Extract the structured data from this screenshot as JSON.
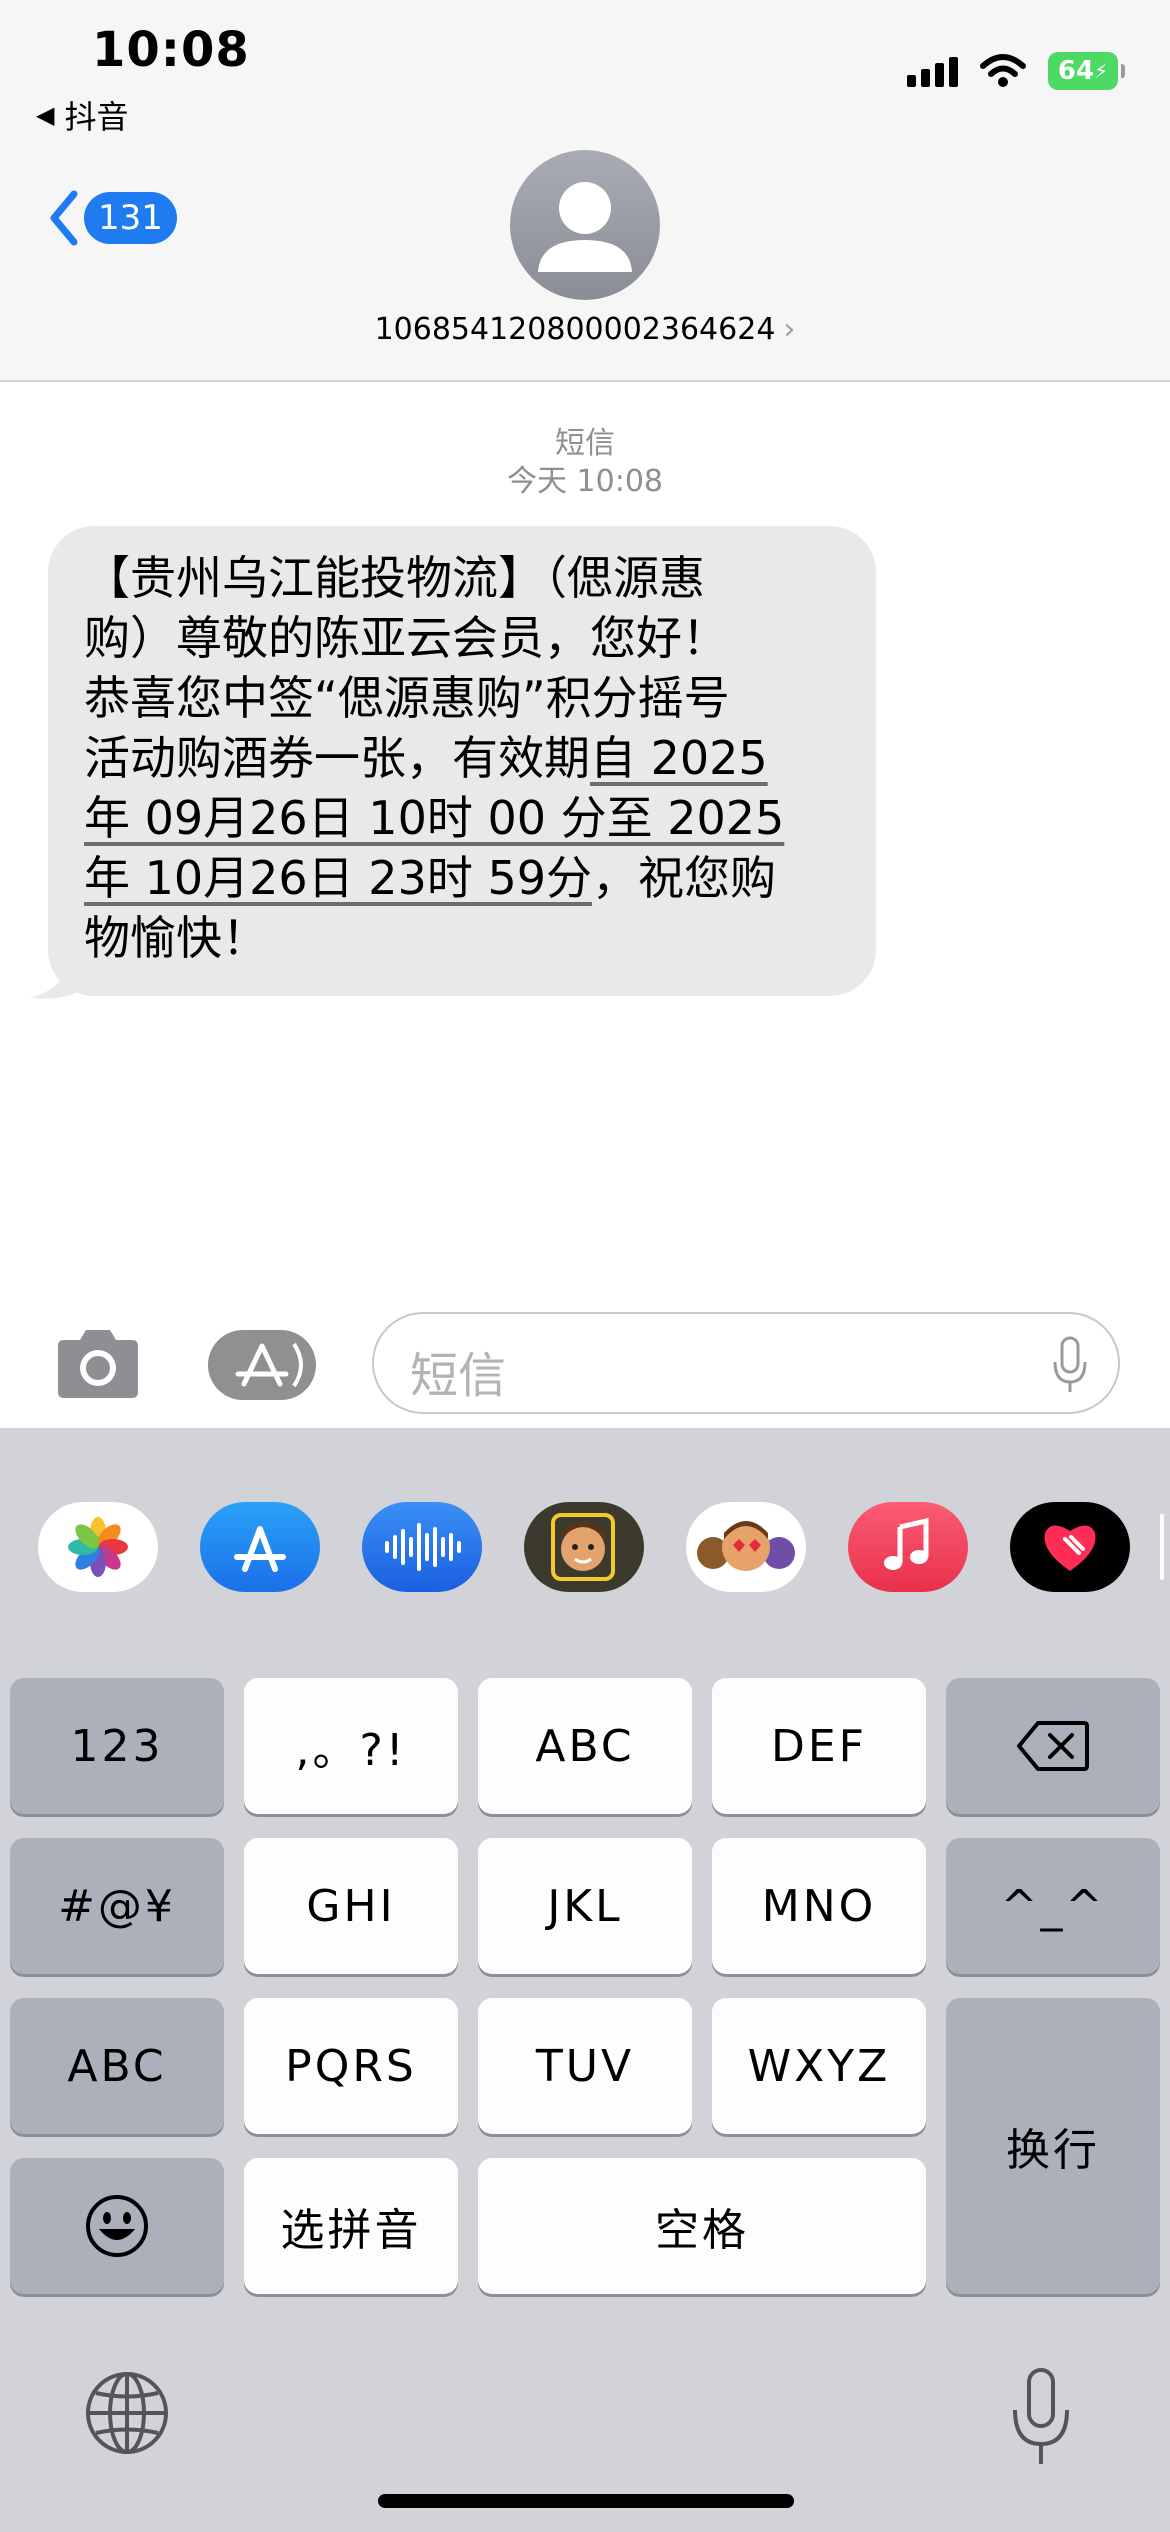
{
  "status_bar": {
    "time": "10:08",
    "back_app": "抖音",
    "battery": "64",
    "icons": [
      "cellular-signal-icon",
      "wifi-icon",
      "battery-charging-icon"
    ]
  },
  "header": {
    "unread_count": "131",
    "contact_number": "106854120800002364624"
  },
  "conversation": {
    "service_label": "短信",
    "timestamp": "今天 10:08",
    "message_lines": [
      "【贵州乌江能投物流】（偲源惠",
      "购）尊敬的陈亚云会员，您好！",
      "恭喜您中签“偲源惠购”积分摇号",
      "活动购酒券一张，有效期",
      "自 2025",
      "年 09月26日 10时 00 分至 2025",
      "年 10月26日 23时 59分",
      "，祝您购",
      "物愉快！"
    ]
  },
  "composer": {
    "placeholder": "短信"
  },
  "app_strip": {
    "apps": [
      "photos-app-icon",
      "app-store-app-icon",
      "audio-message-app-icon",
      "memoji-app-icon",
      "memoji-stickers-app-icon",
      "music-app-icon",
      "digital-touch-app-icon"
    ]
  },
  "keyboard": {
    "keys": {
      "k123": "123",
      "punct": ",。?!",
      "abc": "ABC",
      "def": "DEF",
      "symbols": "#@¥",
      "ghi": "GHI",
      "jkl": "JKL",
      "mno": "MNO",
      "emoticon": "^_^",
      "abc_switch": "ABC",
      "pqrs": "PQRS",
      "tuv": "TUV",
      "wxyz": "WXYZ",
      "return": "换行",
      "pinyin": "选拼音",
      "space": "空格"
    },
    "colors": {
      "light_key": "#fdfdfd",
      "dark_key": "#abb0bb",
      "background": "#d1d3d9",
      "accent": "#1e7cf0"
    }
  }
}
